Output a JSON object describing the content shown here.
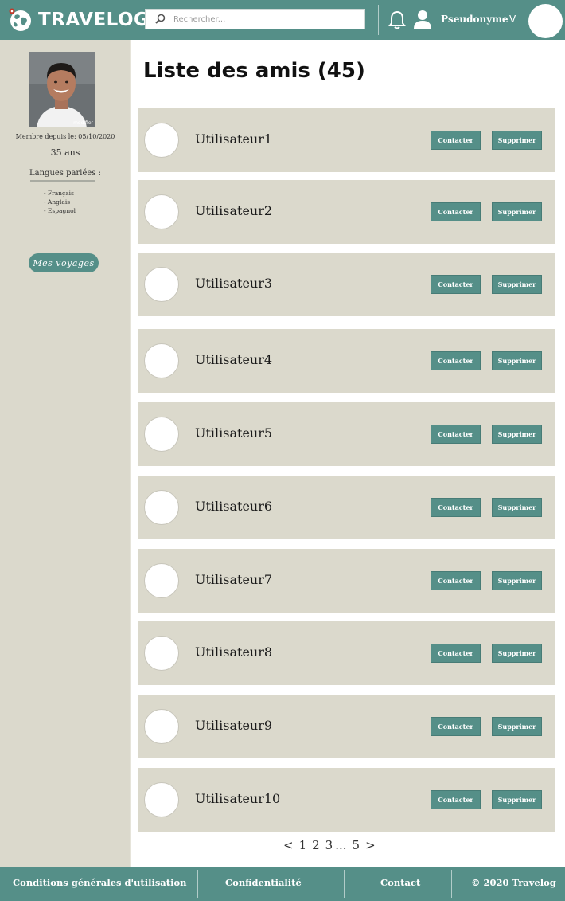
{
  "header": {
    "logo_text": "TRAVELOG",
    "search_placeholder": "Rechercher...",
    "username": "Pseudonyme",
    "dropdown_indicator": "V",
    "icons": [
      "globe-logo-icon",
      "search-icon",
      "bell-icon",
      "user-icon"
    ]
  },
  "sidebar": {
    "photo_edit_label": "modifier",
    "member_since": "Membre depuis le: 05/10/2020",
    "age": "35 ans",
    "languages_title": "Langues parlées :",
    "languages": [
      "- Français",
      "- Anglais",
      "- Espagnol"
    ],
    "trips_button": "Mes voyages"
  },
  "main": {
    "title": "Liste des amis (45)",
    "friends": [
      {
        "name": "Utilisateur1"
      },
      {
        "name": "Utilisateur2"
      },
      {
        "name": "Utilisateur3"
      },
      {
        "name": "Utilisateur4"
      },
      {
        "name": "Utilisateur5"
      },
      {
        "name": "Utilisateur6"
      },
      {
        "name": "Utilisateur7"
      },
      {
        "name": "Utilisateur8"
      },
      {
        "name": "Utilisateur9"
      },
      {
        "name": "Utilisateur10"
      }
    ],
    "contact_label": "Contacter",
    "delete_label": "Supprimer",
    "pagination": {
      "prev": "<",
      "pages": [
        "1",
        "2",
        "3"
      ],
      "ellipsis": "...",
      "last": "5",
      "next": ">"
    }
  },
  "footer": {
    "terms": "Conditions générales d'utilisation",
    "privacy": "Confidentialité",
    "contact": "Contact",
    "copyright": "© 2020 Travelog"
  },
  "colors": {
    "teal": "#558f88",
    "beige": "#dbd9cc",
    "white": "#ffffff"
  }
}
